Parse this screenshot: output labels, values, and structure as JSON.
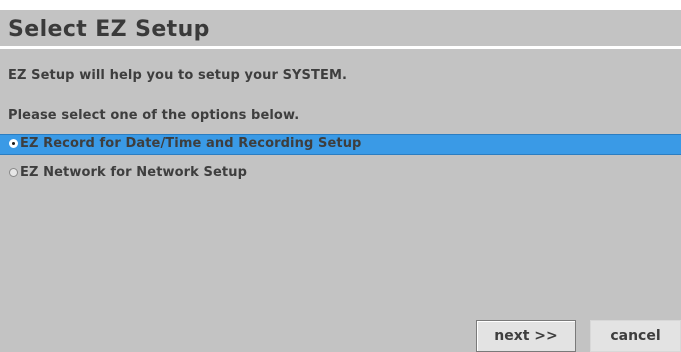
{
  "dialog": {
    "title": "Select EZ Setup",
    "intro": "EZ Setup will help you to setup your SYSTEM.",
    "prompt": "Please select one of the options below."
  },
  "options": [
    {
      "label": "EZ Record for Date/Time and Recording Setup",
      "selected": true
    },
    {
      "label": "EZ Network for Network Setup",
      "selected": false
    }
  ],
  "buttons": {
    "next_label": "next >>",
    "cancel_label": "cancel"
  },
  "colors": {
    "background": "#c3c3c3",
    "highlight": "#3a9ae6",
    "text": "#3e3e3e"
  }
}
